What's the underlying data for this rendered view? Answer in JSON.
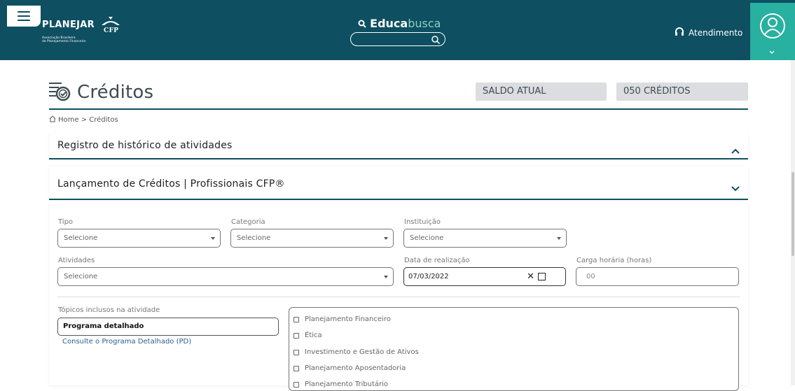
{
  "header": {
    "logo_brand": "PLANEJAR",
    "logo_sub_line1": "Associação Brasileira",
    "logo_sub_line2": "de Planejamento Financeiro",
    "educa_bold": "Educa",
    "educa_light": "busca",
    "search_placeholder": "",
    "atendimento_label": "Atendimento",
    "user_icon": "user-circle-icon"
  },
  "page": {
    "title": "Créditos",
    "saldo_label": "SALDO ATUAL",
    "saldo_value": "050 CRÉDITOS",
    "breadcrumb": "Home > Créditos"
  },
  "accordions": {
    "historico": "Registro de histórico de atividades",
    "lancamento": "Lançamento de Créditos | Profissionais CFP®"
  },
  "form": {
    "tipo_label": "Tipo",
    "tipo_value": "Selecione",
    "categoria_label": "Categoria",
    "categoria_value": "Selecione",
    "instituicao_label": "Instituição",
    "instituicao_value": "Selecione",
    "atividades_label": "Atividades",
    "atividades_value": "Selecione",
    "data_label": "Data de realização",
    "data_value": "07/03/2022",
    "carga_label": "Carga horária (horas)",
    "carga_placeholder": "00",
    "topicos_label": "Tópicos inclusos na atividade",
    "programa_label": "Programa detalhado",
    "consulte_link": "Consulte o Programa Detalhado (PD)",
    "topics": [
      "Planejamento Financeiro",
      "Ética",
      "Investimento e Gestão de Ativos",
      "Planejamento Aposentadoria",
      "Planejamento Tributário"
    ]
  },
  "colors": {
    "primary": "#0e4f61",
    "accent": "#28b0a0",
    "saldo_bg": "#dcdde0"
  }
}
